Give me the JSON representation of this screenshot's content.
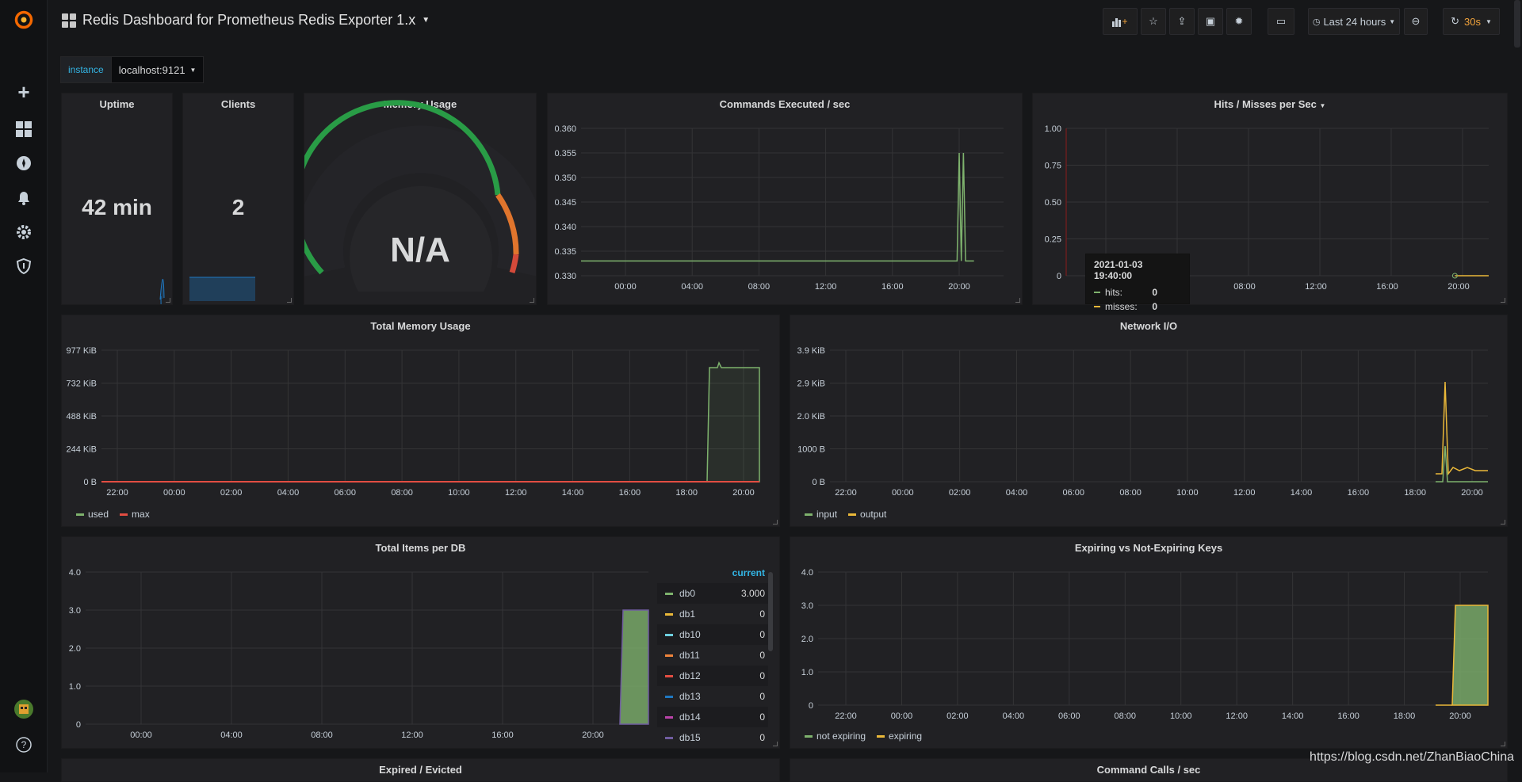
{
  "dashboard": {
    "title": "Redis Dashboard for Prometheus Redis Exporter 1.x"
  },
  "toolbar": {
    "time_range": "Last 24 hours",
    "refresh": "30s"
  },
  "variable": {
    "label": "instance",
    "value": "localhost:9121"
  },
  "panels": {
    "uptime": {
      "title": "Uptime",
      "value": "42 min"
    },
    "clients": {
      "title": "Clients",
      "value": "2"
    },
    "memory": {
      "title": "Memory Usage",
      "value": "N/A"
    },
    "commands": {
      "title": "Commands Executed / sec"
    },
    "hits": {
      "title": "Hits / Misses per Sec"
    },
    "total_memory": {
      "title": "Total Memory Usage"
    },
    "network": {
      "title": "Network I/O"
    },
    "items": {
      "title": "Total Items per DB"
    },
    "expiring": {
      "title": "Expiring vs Not-Expiring Keys"
    },
    "expired": {
      "title": "Expired / Evicted"
    },
    "calls": {
      "title": "Command Calls / sec"
    }
  },
  "tooltip": {
    "time": "2021-01-03 19:40:00",
    "rows": [
      {
        "label": "hits:",
        "value": "0",
        "color": "#7eb26d"
      },
      {
        "label": "misses:",
        "value": "0",
        "color": "#eab839"
      }
    ]
  },
  "colors": {
    "green": "#7eb26d",
    "yellow": "#eab839",
    "red": "#e24d42",
    "blue": "#1f78c1",
    "accent": "#33b5e5",
    "orange": "#f2a33b"
  },
  "chart_data": [
    {
      "id": "commands",
      "type": "line",
      "title": "Commands Executed / sec",
      "y_ticks": [
        "0.360",
        "0.355",
        "0.350",
        "0.345",
        "0.340",
        "0.335",
        "0.330"
      ],
      "x_ticks": [
        "00:00",
        "04:00",
        "08:00",
        "12:00",
        "16:00",
        "20:00"
      ],
      "ylim": [
        0.33,
        0.36
      ],
      "series": [
        {
          "color": "#7eb26d",
          "points": [
            [
              0.0,
              0.333
            ],
            [
              0.86,
              0.333
            ],
            [
              0.89,
              0.333
            ],
            [
              0.895,
              0.355
            ],
            [
              0.9,
              0.333
            ],
            [
              0.905,
              0.355
            ],
            [
              0.91,
              0.333
            ],
            [
              0.93,
              0.333
            ]
          ]
        }
      ]
    },
    {
      "id": "hits",
      "type": "line",
      "title": "Hits / Misses per Sec",
      "y_ticks": [
        "1.00",
        "0.75",
        "0.50",
        "0.25",
        "0"
      ],
      "x_ticks": [
        "08:00",
        "12:00",
        "16:00",
        "20:00"
      ],
      "ylim": [
        0,
        1
      ],
      "series": [
        {
          "name": "hits",
          "color": "#7eb26d",
          "points": []
        },
        {
          "name": "misses",
          "color": "#eab839",
          "points": [
            [
              0.92,
              0
            ],
            [
              1.0,
              0
            ]
          ]
        }
      ]
    },
    {
      "id": "total_memory",
      "type": "area",
      "title": "Total Memory Usage",
      "y_ticks": [
        "977 KiB",
        "732 KiB",
        "488 KiB",
        "244 KiB",
        "0 B"
      ],
      "x_ticks": [
        "22:00",
        "00:00",
        "02:00",
        "04:00",
        "06:00",
        "08:00",
        "10:00",
        "12:00",
        "14:00",
        "16:00",
        "18:00",
        "20:00"
      ],
      "legend": [
        {
          "name": "used",
          "color": "#7eb26d"
        },
        {
          "name": "max",
          "color": "#e24d42"
        }
      ]
    },
    {
      "id": "network",
      "type": "line",
      "title": "Network I/O",
      "y_ticks": [
        "3.9 KiB",
        "2.9 KiB",
        "2.0 KiB",
        "1000 B",
        "0 B"
      ],
      "x_ticks": [
        "22:00",
        "00:00",
        "02:00",
        "04:00",
        "06:00",
        "08:00",
        "10:00",
        "12:00",
        "14:00",
        "16:00",
        "18:00",
        "20:00"
      ],
      "legend": [
        {
          "name": "input",
          "color": "#7eb26d"
        },
        {
          "name": "output",
          "color": "#eab839"
        }
      ]
    },
    {
      "id": "items",
      "type": "area",
      "title": "Total Items per DB",
      "y_ticks": [
        "4.0",
        "3.0",
        "2.0",
        "1.0",
        "0"
      ],
      "x_ticks": [
        "00:00",
        "04:00",
        "08:00",
        "12:00",
        "16:00",
        "20:00"
      ],
      "legend_header": "current",
      "legend": [
        {
          "name": "db0",
          "value": "3.000",
          "color": "#7eb26d"
        },
        {
          "name": "db1",
          "value": "0",
          "color": "#eab839"
        },
        {
          "name": "db10",
          "value": "0",
          "color": "#6ed0e0"
        },
        {
          "name": "db11",
          "value": "0",
          "color": "#ef843c"
        },
        {
          "name": "db12",
          "value": "0",
          "color": "#e24d42"
        },
        {
          "name": "db13",
          "value": "0",
          "color": "#1f78c1"
        },
        {
          "name": "db14",
          "value": "0",
          "color": "#ba43a9"
        },
        {
          "name": "db15",
          "value": "0",
          "color": "#705da0"
        }
      ]
    },
    {
      "id": "expiring",
      "type": "area",
      "title": "Expiring vs Not-Expiring Keys",
      "y_ticks": [
        "4.0",
        "3.0",
        "2.0",
        "1.0",
        "0"
      ],
      "x_ticks": [
        "22:00",
        "00:00",
        "02:00",
        "04:00",
        "06:00",
        "08:00",
        "10:00",
        "12:00",
        "14:00",
        "16:00",
        "18:00",
        "20:00"
      ],
      "legend": [
        {
          "name": "not expiring",
          "color": "#7eb26d"
        },
        {
          "name": "expiring",
          "color": "#eab839"
        }
      ]
    }
  ],
  "watermark": "https://blog.csdn.net/ZhanBiaoChina"
}
